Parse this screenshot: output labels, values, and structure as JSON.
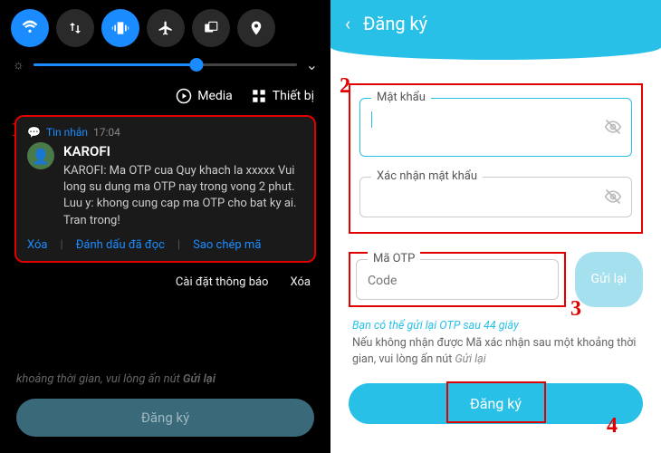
{
  "left": {
    "qs": {
      "icons": [
        "wifi",
        "data-swap",
        "vibrate",
        "airplane",
        "windows",
        "location"
      ]
    },
    "media_label": "Media",
    "device_label": "Thiết bị",
    "notif": {
      "app_label": "Tin nhắn",
      "time": "17:04",
      "title": "KAROFI",
      "body": "KAROFI: Ma OTP cua Quy khach la xxxxx   Vui long su dung ma OTP nay trong vong 2 phut. Luu y: khong cung cap ma OTP cho bat ky ai. Tran trong!",
      "action_delete": "Xóa",
      "action_mark": "Đánh dấu đã đọc",
      "action_copy": "Sao chép mã"
    },
    "footer_settings": "Cài đặt thông báo",
    "footer_clear": "Xóa",
    "dim_text_prefix": "khoảng thời gian, vui lòng ấn nút ",
    "dim_text_link": "Gửi lại",
    "dim_button": "Đăng ký"
  },
  "right": {
    "header_title": "Đăng ký",
    "password_label": "Mật khẩu",
    "confirm_label": "Xác nhận mật khẩu",
    "otp_label": "Mã OTP",
    "otp_placeholder": "Code",
    "resend_button": "Gửi lại",
    "hint_countdown": "Bạn có thể gửi lại OTP sau 44 giây",
    "hint_text_1": "Nếu không nhận được Mã xác nhận sau một khoảng thời gian, vui lòng ấn nút ",
    "hint_link": "Gửi lại",
    "submit": "Đăng ký"
  },
  "markers": {
    "m1": "1",
    "m2": "2",
    "m3": "3",
    "m4": "4"
  }
}
